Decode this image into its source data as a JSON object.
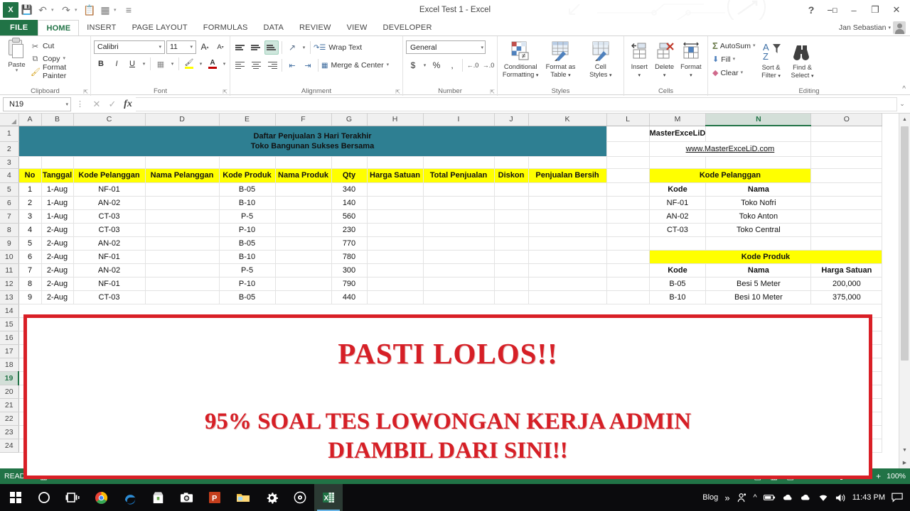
{
  "window": {
    "title": "Excel Test 1 - Excel",
    "user": "Jan Sebastian",
    "help_icon": "?",
    "ribbon_display_icon": "ribbon-display-options",
    "minimize_icon": "–",
    "restore_icon": "❐",
    "close_icon": "✕",
    "logo_text": "X"
  },
  "qat": {
    "save_icon": "save-icon",
    "undo_icon": "undo-icon",
    "redo_icon": "redo-icon",
    "paste_icon": "paste-icon",
    "table_icon": "table-icon",
    "customize_icon": "customize-icon"
  },
  "tabs": [
    {
      "label": "FILE",
      "active": false
    },
    {
      "label": "HOME",
      "active": true
    },
    {
      "label": "INSERT",
      "active": false
    },
    {
      "label": "PAGE LAYOUT",
      "active": false
    },
    {
      "label": "FORMULAS",
      "active": false
    },
    {
      "label": "DATA",
      "active": false
    },
    {
      "label": "REVIEW",
      "active": false
    },
    {
      "label": "VIEW",
      "active": false
    },
    {
      "label": "DEVELOPER",
      "active": false
    }
  ],
  "ribbon": {
    "clipboard": {
      "label": "Clipboard",
      "paste": "Paste",
      "cut": "Cut",
      "copy": "Copy",
      "format_painter": "Format Painter"
    },
    "font": {
      "label": "Font",
      "family": "Calibri",
      "size": "11",
      "grow": "A",
      "shrink": "A",
      "bold": "B",
      "italic": "I",
      "underline": "U"
    },
    "alignment": {
      "label": "Alignment",
      "wrap_text": "Wrap Text",
      "merge_center": "Merge & Center"
    },
    "number": {
      "label": "Number",
      "format": "General",
      "currency": "$",
      "percent": "%",
      "comma": ","
    },
    "styles": {
      "label": "Styles",
      "conditional_formatting": "Conditional\nFormatting",
      "conditional_formatting_l1": "Conditional",
      "conditional_formatting_l2": "Formatting",
      "format_as_table_l1": "Format as",
      "format_as_table_l2": "Table",
      "cell_styles_l1": "Cell",
      "cell_styles_l2": "Styles"
    },
    "cells": {
      "label": "Cells",
      "insert": "Insert",
      "delete": "Delete",
      "format": "Format"
    },
    "editing": {
      "label": "Editing",
      "autosum": "AutoSum",
      "fill": "Fill",
      "clear": "Clear",
      "sort_filter_l1": "Sort &",
      "sort_filter_l2": "Filter",
      "find_select_l1": "Find &",
      "find_select_l2": "Select"
    },
    "collapse": "^"
  },
  "formula_bar": {
    "name_box": "N19",
    "cancel_icon": "✕",
    "enter_icon": "✓",
    "function_icon": "fx",
    "value": "",
    "expand_icon": "⌄"
  },
  "sheet": {
    "columns": [
      "A",
      "B",
      "C",
      "D",
      "E",
      "F",
      "G",
      "H",
      "I",
      "J",
      "K",
      "L",
      "M",
      "N",
      "O"
    ],
    "selected_column": "N",
    "selected_row": 19,
    "rows": [
      1,
      2,
      3,
      4,
      5,
      6,
      7,
      8,
      9,
      10,
      11,
      12,
      13,
      14,
      15,
      16,
      17,
      18,
      19,
      20,
      21,
      22,
      23,
      24
    ],
    "title_line1": "Daftar Penjualan 3 Hari Terakhir",
    "title_line2": "Toko Bangunan Sukses Bersama",
    "brand_text": "MasterExceLiD",
    "brand_url": "www.MasterExceLiD.com",
    "table_headers": [
      "No",
      "Tanggal",
      "Kode Pelanggan",
      "Nama Pelanggan",
      "Kode Produk",
      "Nama Produk",
      "Qty",
      "Harga Satuan",
      "Total Penjualan",
      "Diskon",
      "Penjualan Bersih"
    ],
    "table_rows": [
      {
        "no": "1",
        "tanggal": "1-Aug",
        "kode_pelanggan": "NF-01",
        "nama_pelanggan": "",
        "kode_produk": "B-05",
        "nama_produk": "",
        "qty": "340",
        "harga_satuan": "",
        "total": "",
        "diskon": "",
        "bersih": ""
      },
      {
        "no": "2",
        "tanggal": "1-Aug",
        "kode_pelanggan": "AN-02",
        "nama_pelanggan": "",
        "kode_produk": "B-10",
        "nama_produk": "",
        "qty": "140",
        "harga_satuan": "",
        "total": "",
        "diskon": "",
        "bersih": ""
      },
      {
        "no": "3",
        "tanggal": "1-Aug",
        "kode_pelanggan": "CT-03",
        "nama_pelanggan": "",
        "kode_produk": "P-5",
        "nama_produk": "",
        "qty": "560",
        "harga_satuan": "",
        "total": "",
        "diskon": "",
        "bersih": ""
      },
      {
        "no": "4",
        "tanggal": "2-Aug",
        "kode_pelanggan": "CT-03",
        "nama_pelanggan": "",
        "kode_produk": "P-10",
        "nama_produk": "",
        "qty": "230",
        "harga_satuan": "",
        "total": "",
        "diskon": "",
        "bersih": ""
      },
      {
        "no": "5",
        "tanggal": "2-Aug",
        "kode_pelanggan": "AN-02",
        "nama_pelanggan": "",
        "kode_produk": "B-05",
        "nama_produk": "",
        "qty": "770",
        "harga_satuan": "",
        "total": "",
        "diskon": "",
        "bersih": ""
      },
      {
        "no": "6",
        "tanggal": "2-Aug",
        "kode_pelanggan": "NF-01",
        "nama_pelanggan": "",
        "kode_produk": "B-10",
        "nama_produk": "",
        "qty": "780",
        "harga_satuan": "",
        "total": "",
        "diskon": "",
        "bersih": ""
      },
      {
        "no": "7",
        "tanggal": "2-Aug",
        "kode_pelanggan": "AN-02",
        "nama_pelanggan": "",
        "kode_produk": "P-5",
        "nama_produk": "",
        "qty": "300",
        "harga_satuan": "",
        "total": "",
        "diskon": "",
        "bersih": ""
      },
      {
        "no": "8",
        "tanggal": "2-Aug",
        "kode_pelanggan": "NF-01",
        "nama_pelanggan": "",
        "kode_produk": "P-10",
        "nama_produk": "",
        "qty": "790",
        "harga_satuan": "",
        "total": "",
        "diskon": "",
        "bersih": ""
      },
      {
        "no": "9",
        "tanggal": "2-Aug",
        "kode_pelanggan": "CT-03",
        "nama_pelanggan": "",
        "kode_produk": "B-05",
        "nama_produk": "",
        "qty": "440",
        "harga_satuan": "",
        "total": "",
        "diskon": "",
        "bersih": ""
      }
    ],
    "lookup_pelanggan": {
      "title": "Kode Pelanggan",
      "headers": [
        "Kode",
        "Nama"
      ],
      "rows": [
        {
          "kode": "NF-01",
          "nama": "Toko Nofri"
        },
        {
          "kode": "AN-02",
          "nama": "Toko Anton"
        },
        {
          "kode": "CT-03",
          "nama": "Toko Central"
        }
      ]
    },
    "lookup_produk": {
      "title": "Kode Produk",
      "headers": [
        "Kode",
        "Nama",
        "Harga Satuan"
      ],
      "rows": [
        {
          "kode": "B-05",
          "nama": "Besi 5 Meter",
          "harga": "200,000"
        },
        {
          "kode": "B-10",
          "nama": "Besi 10 Meter",
          "harga": "375,000"
        }
      ]
    }
  },
  "overlay": {
    "line1": "PASTI LOLOS!!",
    "line2": "95% SOAL TES LOWONGAN KERJA ADMIN",
    "line3": "DIAMBIL DARI SINI!!",
    "border_color": "#d91f26",
    "text_color": "#d61f26"
  },
  "status_bar": {
    "state": "READY",
    "macro_icon": "record-macro-icon",
    "view_normal_icon": "normal-view-icon",
    "view_layout_icon": "page-layout-view-icon",
    "view_break_icon": "page-break-view-icon",
    "zoom_out": "–",
    "zoom_in": "+",
    "zoom_level": "100%"
  },
  "taskbar": {
    "items": [
      {
        "name": "start-button",
        "glyph": "windows"
      },
      {
        "name": "cortana-search",
        "glyph": "circle"
      },
      {
        "name": "task-view",
        "glyph": "taskview"
      },
      {
        "name": "chrome",
        "glyph": "chrome"
      },
      {
        "name": "edge",
        "glyph": "edge"
      },
      {
        "name": "store",
        "glyph": "store"
      },
      {
        "name": "camera",
        "glyph": "camera"
      },
      {
        "name": "powerpoint",
        "glyph": "powerpoint"
      },
      {
        "name": "file-explorer",
        "glyph": "folder"
      },
      {
        "name": "settings",
        "glyph": "gear"
      },
      {
        "name": "media-player",
        "glyph": "disc"
      },
      {
        "name": "excel",
        "glyph": "excel",
        "active": true
      }
    ],
    "tray_label": "Blog",
    "tray_overflow": "»",
    "tray_people_icon": "people-icon",
    "tray_chevron_icon": "show-hidden-icons",
    "tray_battery_icon": "battery-icon",
    "tray_cloud1_icon": "onedrive-icon",
    "tray_cloud2_icon": "onedrive-personal-icon",
    "tray_wifi_icon": "wifi-icon",
    "tray_volume_icon": "volume-icon",
    "clock": "11:43 PM",
    "action_center_icon": "action-center-icon"
  },
  "colors": {
    "excel_green": "#217346",
    "teal_header": "#2e7f92",
    "yellow_header": "#ffff00",
    "brand_red": "#c00000",
    "link_blue": "#0563c1"
  }
}
